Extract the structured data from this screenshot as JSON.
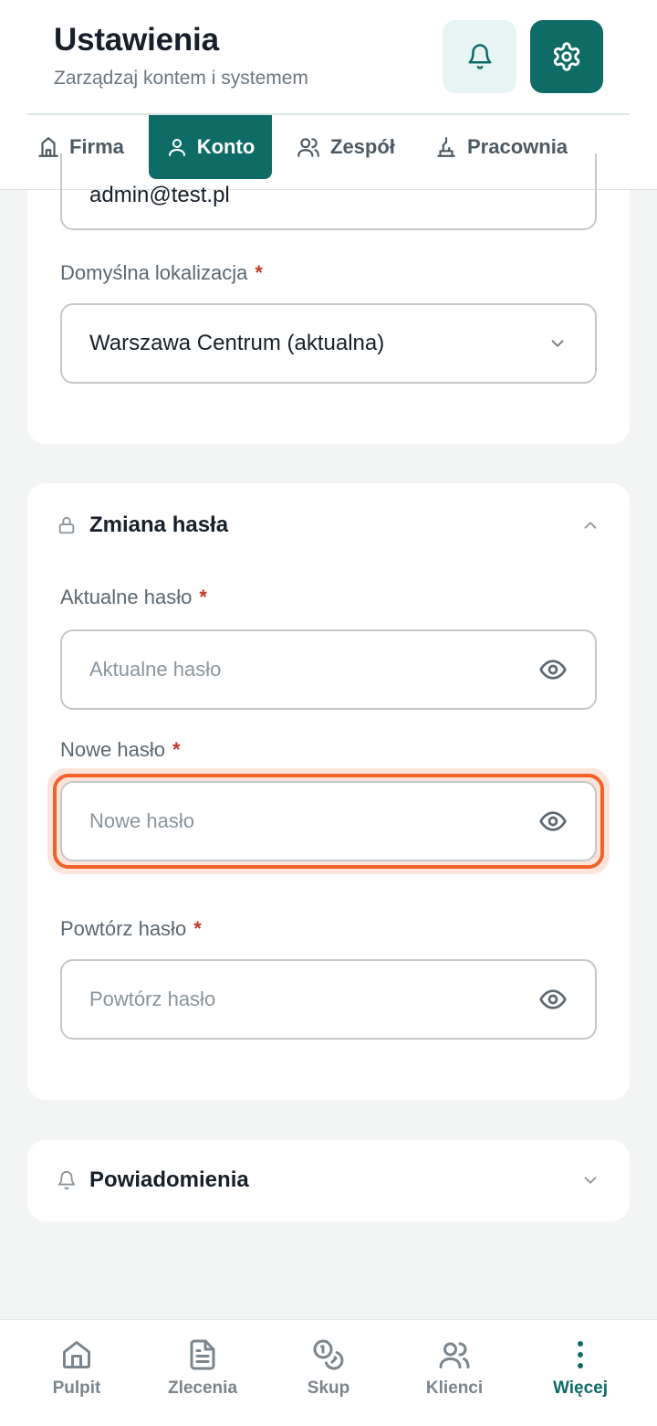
{
  "header": {
    "title": "Ustawienia",
    "subtitle": "Zarządzaj kontem i systemem"
  },
  "tabs": [
    {
      "label": "Firma",
      "icon": "building-icon",
      "active": false
    },
    {
      "label": "Konto",
      "icon": "user-icon",
      "active": true
    },
    {
      "label": "Zespół",
      "icon": "users-icon",
      "active": false
    },
    {
      "label": "Pracownia",
      "icon": "workshop-icon",
      "active": false
    }
  ],
  "account": {
    "email_value": "admin@test.pl",
    "location_label": "Domyślna lokalizacja",
    "location_value": "Warszawa Centrum (aktualna)",
    "required_mark": "*"
  },
  "password_section": {
    "title": "Zmiana hasła",
    "current_label": "Aktualne hasło",
    "current_placeholder": "Aktualne hasło",
    "new_label": "Nowe hasło",
    "new_placeholder": "Nowe hasło",
    "repeat_label": "Powtórz hasło",
    "repeat_placeholder": "Powtórz hasło"
  },
  "notifications_section": {
    "title": "Powiadomienia"
  },
  "bottom_nav": [
    {
      "label": "Pulpit",
      "icon": "home-icon",
      "active": false
    },
    {
      "label": "Zlecenia",
      "icon": "document-icon",
      "active": false
    },
    {
      "label": "Skup",
      "icon": "coins-icon",
      "active": false
    },
    {
      "label": "Klienci",
      "icon": "users-icon",
      "active": false
    },
    {
      "label": "Więcej",
      "icon": "more-vertical-icon",
      "active": true
    }
  ],
  "colors": {
    "accent": "#0e6b66",
    "accent_light": "#e6f4f3",
    "focus": "#f0622a",
    "required": "#c0392b"
  }
}
